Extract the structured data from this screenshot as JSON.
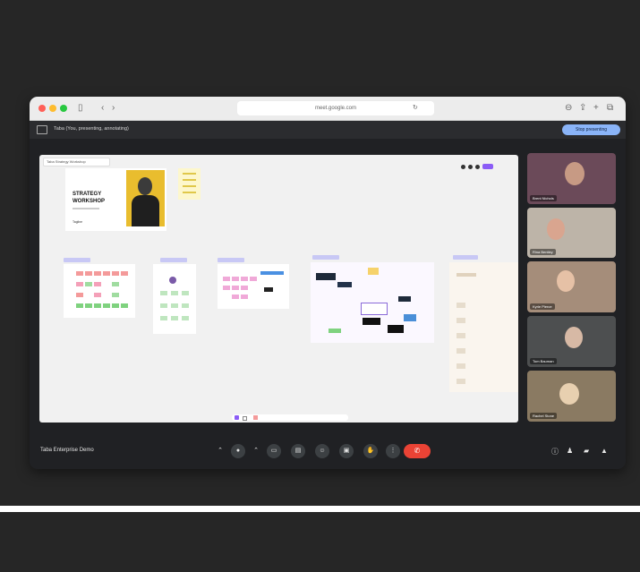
{
  "browser": {
    "url": "meet.google.com",
    "nav_icons": [
      "sidebar-icon",
      "back-icon",
      "forward-icon"
    ],
    "right_icons": [
      "download-icon",
      "share-icon",
      "new-tab-icon",
      "tabs-icon"
    ]
  },
  "meet": {
    "presenting_title": "Taba (You, presenting, annotating)",
    "stop_presenting_label": "Stop presenting",
    "meeting_name": "Taba Enterprise Demo"
  },
  "board": {
    "tab_label": "Taba Strategy Workshop",
    "hero_title": "STRATEGY WORKSHOP",
    "hero_tag": "Tagline"
  },
  "participants": [
    {
      "name": "Brent Nichols",
      "bg": "#6b4a59"
    },
    {
      "name": "Rina Bentley",
      "bg": "#bdb4a8"
    },
    {
      "name": "Kyrie Pierce",
      "bg": "#a58d7a"
    },
    {
      "name": "Tom Bauman",
      "bg": "#4d4f50"
    },
    {
      "name": "Rachel Stone",
      "bg": "#8a7a62"
    }
  ],
  "controls": [
    "chevron-up-icon",
    "mic-icon",
    "chevron-up-icon",
    "camera-icon",
    "captions-icon",
    "emoji-icon",
    "present-icon",
    "raise-hand-icon",
    "more-icon"
  ],
  "right_controls": [
    "info-icon",
    "people-icon",
    "chat-icon",
    "activities-icon"
  ],
  "colors": {
    "accent": "#8ab4f8",
    "end_call": "#ea4335",
    "background": "#262626",
    "panel": "#202124"
  }
}
